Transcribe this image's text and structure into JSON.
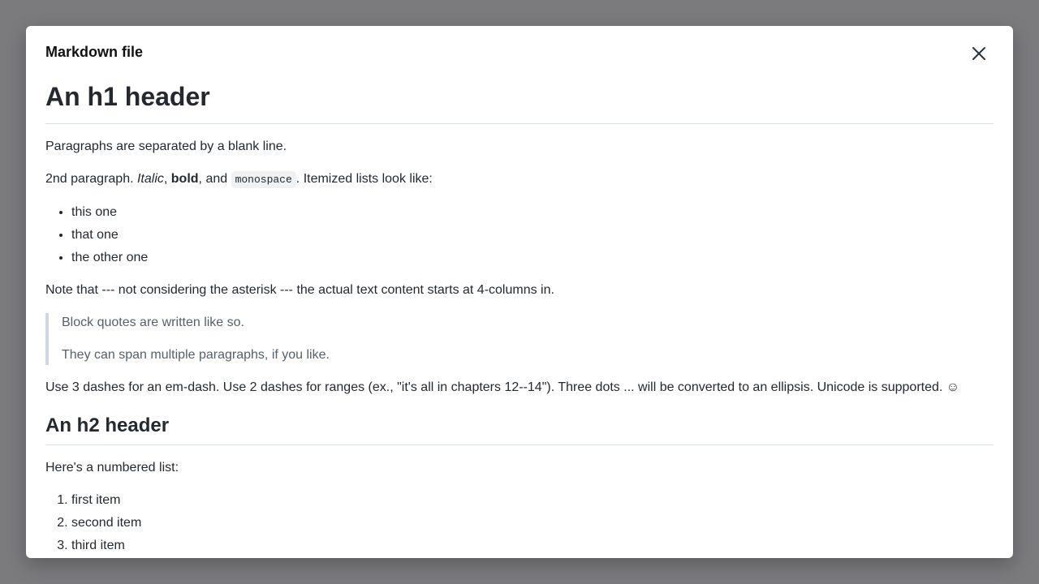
{
  "dialog": {
    "title": "Markdown file",
    "close_icon": "close-icon"
  },
  "doc": {
    "h1": "An h1 header",
    "p1": "Paragraphs are separated by a blank line.",
    "p2": {
      "prefix": "2nd paragraph. ",
      "italic": "Italic",
      "sep1": ", ",
      "bold": "bold",
      "sep2": ", and ",
      "mono": "monospace",
      "suffix": ". Itemized lists look like:"
    },
    "bullets": [
      "this one",
      "that one",
      "the other one"
    ],
    "note": "Note that --- not considering the asterisk --- the actual text content starts at 4-columns in.",
    "quote": [
      "Block quotes are written like so.",
      "They can span multiple paragraphs, if you like."
    ],
    "dashes": "Use 3 dashes for an em-dash. Use 2 dashes for ranges (ex., \"it's all in chapters 12--14\"). Three dots ... will be converted to an ellipsis. Unicode is supported. ☺",
    "h2": "An h2 header",
    "numbered_intro": "Here's a numbered list:",
    "numbered": [
      "first item",
      "second item",
      "third item"
    ]
  }
}
